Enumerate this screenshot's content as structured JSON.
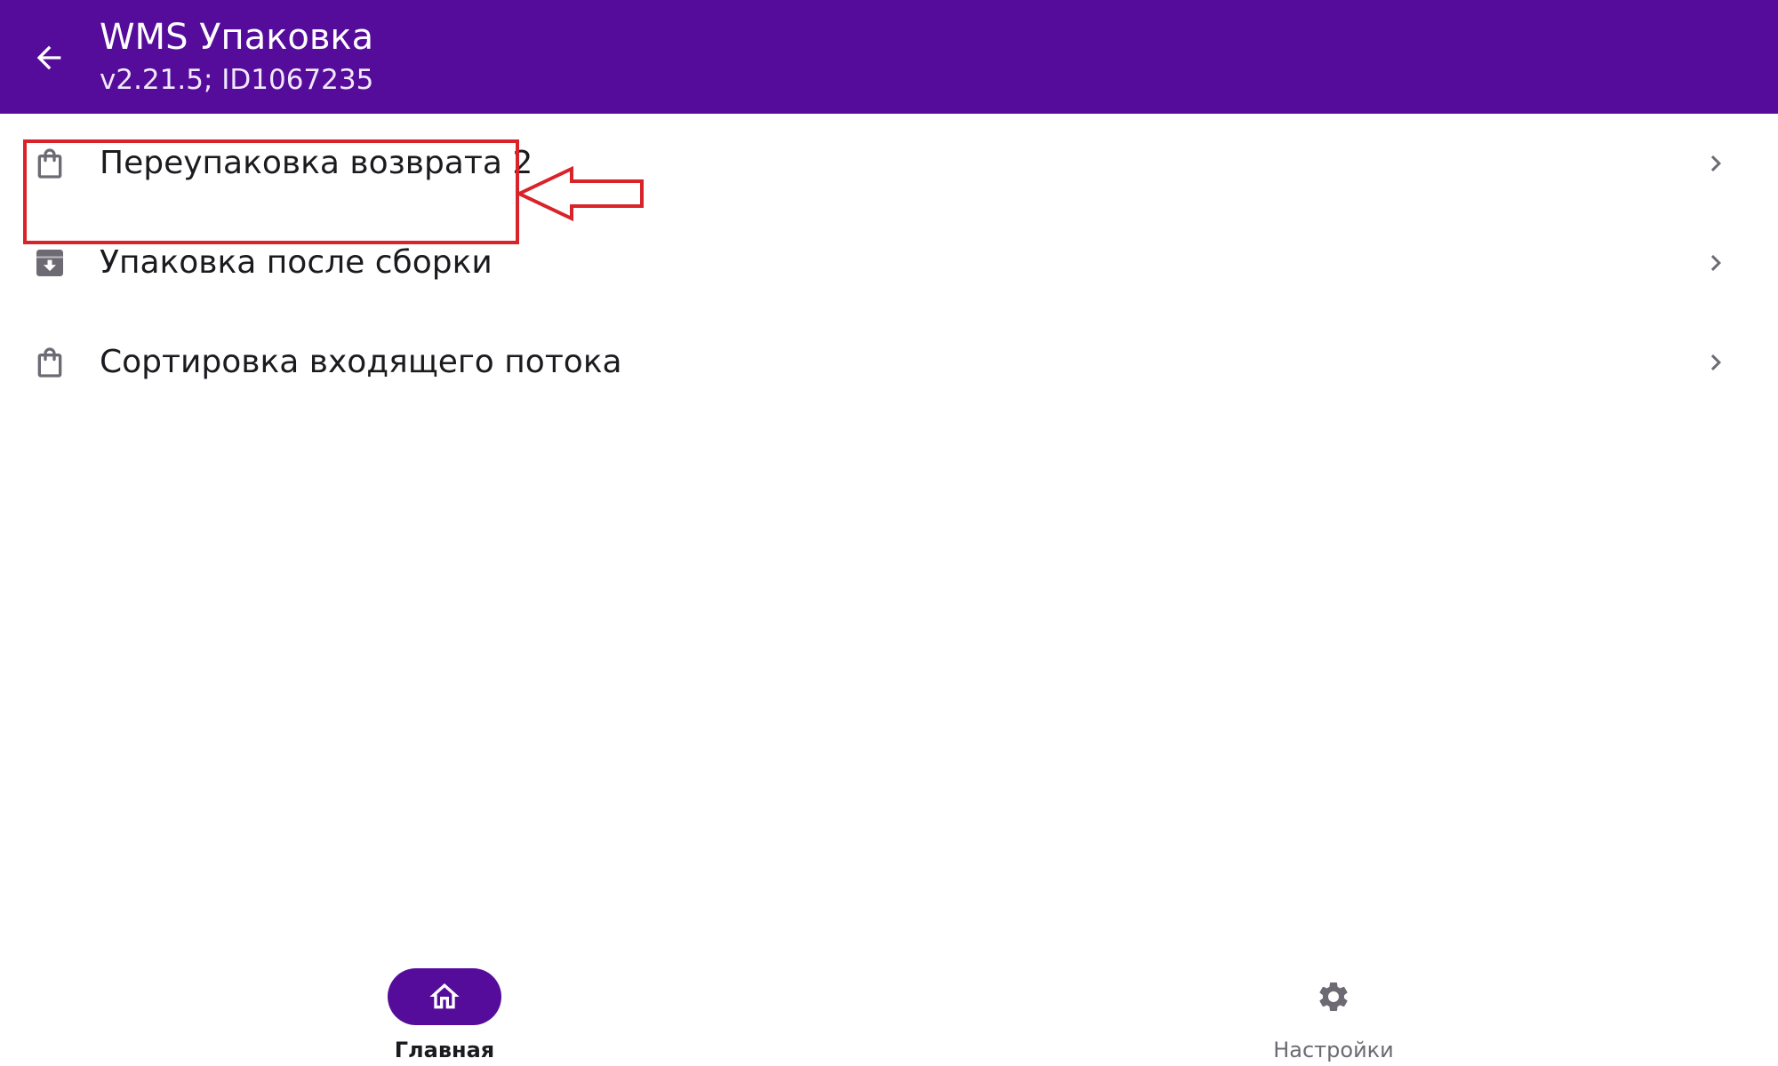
{
  "header": {
    "title": "WMS Упаковка",
    "subtitle": "v2.21.5; ID1067235",
    "background_color": "#560c9a",
    "back_icon": "arrow-back-icon"
  },
  "menu": {
    "items": [
      {
        "label": "Переупаковка возврата 2",
        "icon": "shopping-bag-icon",
        "highlighted": true
      },
      {
        "label": "Упаковка после сборки",
        "icon": "archive-box-icon",
        "highlighted": false
      },
      {
        "label": "Сортировка входящего потока",
        "icon": "shopping-bag-icon",
        "highlighted": false
      }
    ],
    "chevron_icon": "chevron-right-icon"
  },
  "annotation": {
    "color": "#d8232a",
    "target": "Переупаковка возврата 2",
    "arrow_direction": "left"
  },
  "bottom_nav": {
    "items": [
      {
        "label": "Главная",
        "icon": "home-icon",
        "active": true
      },
      {
        "label": "Настройки",
        "icon": "gear-icon",
        "active": false
      }
    ],
    "active_color": "#560c9a"
  }
}
